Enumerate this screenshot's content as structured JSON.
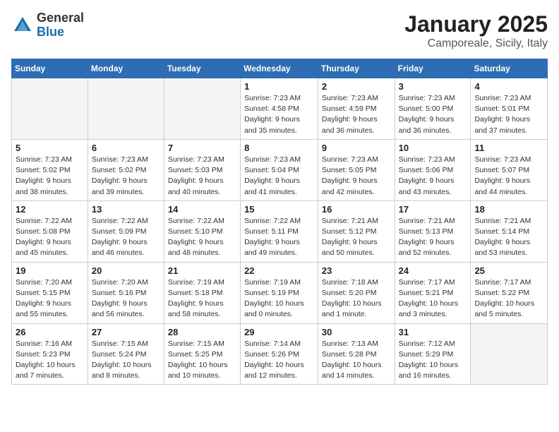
{
  "logo": {
    "general": "General",
    "blue": "Blue"
  },
  "title": "January 2025",
  "subtitle": "Camporeale, Sicily, Italy",
  "days_of_week": [
    "Sunday",
    "Monday",
    "Tuesday",
    "Wednesday",
    "Thursday",
    "Friday",
    "Saturday"
  ],
  "weeks": [
    [
      {
        "day": "",
        "info": ""
      },
      {
        "day": "",
        "info": ""
      },
      {
        "day": "",
        "info": ""
      },
      {
        "day": "1",
        "info": "Sunrise: 7:23 AM\nSunset: 4:58 PM\nDaylight: 9 hours\nand 35 minutes."
      },
      {
        "day": "2",
        "info": "Sunrise: 7:23 AM\nSunset: 4:59 PM\nDaylight: 9 hours\nand 36 minutes."
      },
      {
        "day": "3",
        "info": "Sunrise: 7:23 AM\nSunset: 5:00 PM\nDaylight: 9 hours\nand 36 minutes."
      },
      {
        "day": "4",
        "info": "Sunrise: 7:23 AM\nSunset: 5:01 PM\nDaylight: 9 hours\nand 37 minutes."
      }
    ],
    [
      {
        "day": "5",
        "info": "Sunrise: 7:23 AM\nSunset: 5:02 PM\nDaylight: 9 hours\nand 38 minutes."
      },
      {
        "day": "6",
        "info": "Sunrise: 7:23 AM\nSunset: 5:02 PM\nDaylight: 9 hours\nand 39 minutes."
      },
      {
        "day": "7",
        "info": "Sunrise: 7:23 AM\nSunset: 5:03 PM\nDaylight: 9 hours\nand 40 minutes."
      },
      {
        "day": "8",
        "info": "Sunrise: 7:23 AM\nSunset: 5:04 PM\nDaylight: 9 hours\nand 41 minutes."
      },
      {
        "day": "9",
        "info": "Sunrise: 7:23 AM\nSunset: 5:05 PM\nDaylight: 9 hours\nand 42 minutes."
      },
      {
        "day": "10",
        "info": "Sunrise: 7:23 AM\nSunset: 5:06 PM\nDaylight: 9 hours\nand 43 minutes."
      },
      {
        "day": "11",
        "info": "Sunrise: 7:23 AM\nSunset: 5:07 PM\nDaylight: 9 hours\nand 44 minutes."
      }
    ],
    [
      {
        "day": "12",
        "info": "Sunrise: 7:22 AM\nSunset: 5:08 PM\nDaylight: 9 hours\nand 45 minutes."
      },
      {
        "day": "13",
        "info": "Sunrise: 7:22 AM\nSunset: 5:09 PM\nDaylight: 9 hours\nand 46 minutes."
      },
      {
        "day": "14",
        "info": "Sunrise: 7:22 AM\nSunset: 5:10 PM\nDaylight: 9 hours\nand 48 minutes."
      },
      {
        "day": "15",
        "info": "Sunrise: 7:22 AM\nSunset: 5:11 PM\nDaylight: 9 hours\nand 49 minutes."
      },
      {
        "day": "16",
        "info": "Sunrise: 7:21 AM\nSunset: 5:12 PM\nDaylight: 9 hours\nand 50 minutes."
      },
      {
        "day": "17",
        "info": "Sunrise: 7:21 AM\nSunset: 5:13 PM\nDaylight: 9 hours\nand 52 minutes."
      },
      {
        "day": "18",
        "info": "Sunrise: 7:21 AM\nSunset: 5:14 PM\nDaylight: 9 hours\nand 53 minutes."
      }
    ],
    [
      {
        "day": "19",
        "info": "Sunrise: 7:20 AM\nSunset: 5:15 PM\nDaylight: 9 hours\nand 55 minutes."
      },
      {
        "day": "20",
        "info": "Sunrise: 7:20 AM\nSunset: 5:16 PM\nDaylight: 9 hours\nand 56 minutes."
      },
      {
        "day": "21",
        "info": "Sunrise: 7:19 AM\nSunset: 5:18 PM\nDaylight: 9 hours\nand 58 minutes."
      },
      {
        "day": "22",
        "info": "Sunrise: 7:19 AM\nSunset: 5:19 PM\nDaylight: 10 hours\nand 0 minutes."
      },
      {
        "day": "23",
        "info": "Sunrise: 7:18 AM\nSunset: 5:20 PM\nDaylight: 10 hours\nand 1 minute."
      },
      {
        "day": "24",
        "info": "Sunrise: 7:17 AM\nSunset: 5:21 PM\nDaylight: 10 hours\nand 3 minutes."
      },
      {
        "day": "25",
        "info": "Sunrise: 7:17 AM\nSunset: 5:22 PM\nDaylight: 10 hours\nand 5 minutes."
      }
    ],
    [
      {
        "day": "26",
        "info": "Sunrise: 7:16 AM\nSunset: 5:23 PM\nDaylight: 10 hours\nand 7 minutes."
      },
      {
        "day": "27",
        "info": "Sunrise: 7:15 AM\nSunset: 5:24 PM\nDaylight: 10 hours\nand 8 minutes."
      },
      {
        "day": "28",
        "info": "Sunrise: 7:15 AM\nSunset: 5:25 PM\nDaylight: 10 hours\nand 10 minutes."
      },
      {
        "day": "29",
        "info": "Sunrise: 7:14 AM\nSunset: 5:26 PM\nDaylight: 10 hours\nand 12 minutes."
      },
      {
        "day": "30",
        "info": "Sunrise: 7:13 AM\nSunset: 5:28 PM\nDaylight: 10 hours\nand 14 minutes."
      },
      {
        "day": "31",
        "info": "Sunrise: 7:12 AM\nSunset: 5:29 PM\nDaylight: 10 hours\nand 16 minutes."
      },
      {
        "day": "",
        "info": ""
      }
    ]
  ]
}
